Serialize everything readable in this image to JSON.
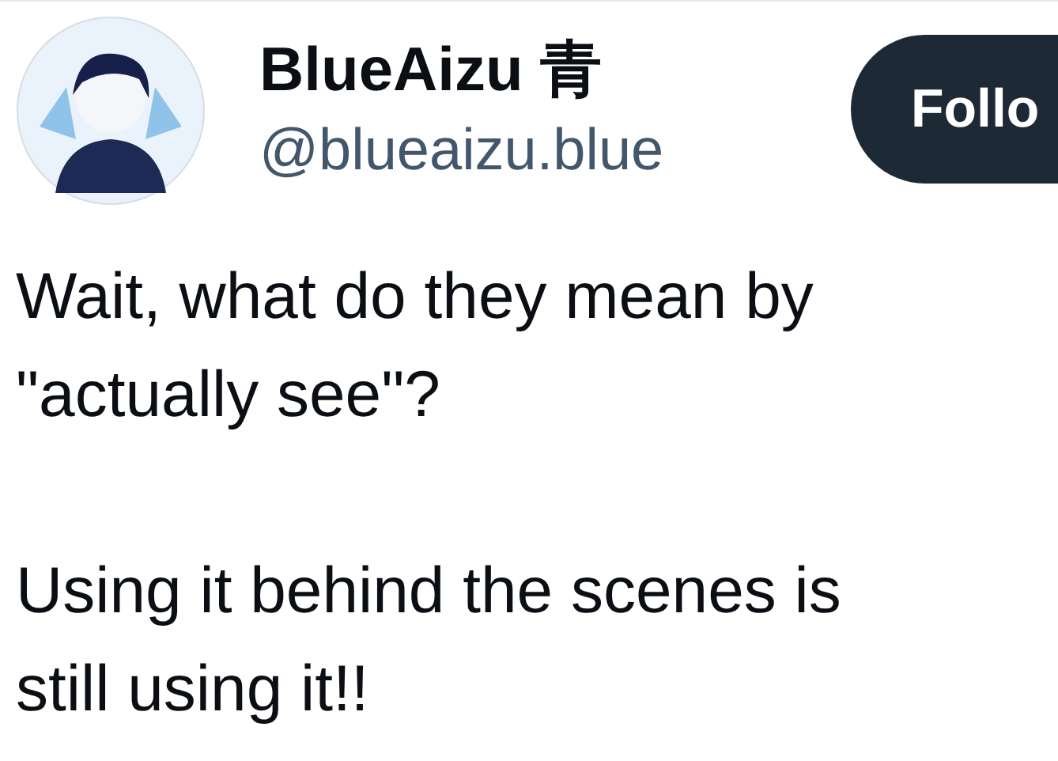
{
  "author": {
    "name": "BlueAizu 青",
    "handle": "@blueaizu.blue"
  },
  "follow_button": {
    "label": "Follo"
  },
  "post": {
    "text": "Wait, what do they mean by\n\"actually see\"?\n\nUsing it behind the scenes is\nstill using it!!"
  }
}
